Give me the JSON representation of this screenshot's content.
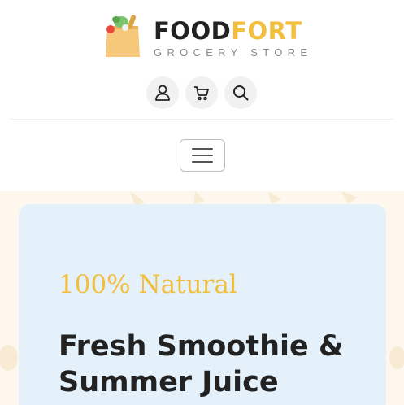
{
  "brand": {
    "name_part1": "FOOD",
    "name_part2": "FORT",
    "subtitle": "GROCERY STORE",
    "accent_color": "#f2be3e"
  },
  "header_icons": [
    "user-icon",
    "cart-icon",
    "search-icon"
  ],
  "nav": {
    "toggler_icon": "hamburger-icon"
  },
  "hero": {
    "tagline": "100% Natural",
    "headline_line1": "Fresh Smoothie &",
    "headline_line2": "Summer Juice",
    "card_color": "#e5f1fa"
  }
}
